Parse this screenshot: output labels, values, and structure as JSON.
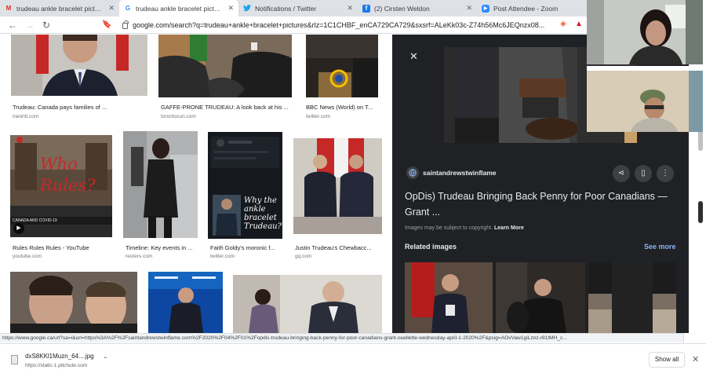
{
  "tabs": [
    {
      "icon": "gmail-icon",
      "title": "trudeau ankle bracelet pictures -",
      "active": false
    },
    {
      "icon": "google-icon",
      "title": "trudeau ankle bracelet pictures",
      "active": true
    },
    {
      "icon": "twitter-icon",
      "title": "Notifications / Twitter",
      "active": false
    },
    {
      "icon": "facebook-icon",
      "title": "(2) Cirsten Weldon",
      "active": false
    },
    {
      "icon": "zoom-icon",
      "title": "Post Attendee - Zoom",
      "active": false
    }
  ],
  "address_bar": {
    "url": "google.com/search?q=trudeau+ankle+bracelet+pictures&rlz=1C1CHBF_enCA729CA729&sxsrf=ALeKk03c-Z74h56Mc6JEQnzx08..."
  },
  "results": [
    {
      "caption": "Trudeau: Canada pays families of ...",
      "source": "iranintl.com"
    },
    {
      "caption": "GAFFE-PRONE TRUDEAU: A look back at his ...",
      "source": "torontosun.com"
    },
    {
      "caption": "BBC News (World) on T...",
      "source": "twitter.com"
    },
    {
      "caption": "Rules Rules Rules - YouTube",
      "source": "youtube.com"
    },
    {
      "caption": "Timeline: Key events in ...",
      "source": "reuters.com"
    },
    {
      "caption": "Faith Goldy's moronic f...",
      "source": "twitter.com"
    },
    {
      "caption": "Justin Trudeau's Chewbacc...",
      "source": "gq.com"
    }
  ],
  "thumb_text": {
    "youtube": "Who Rules?",
    "youtube_banner": "CANADA AND COVID-19",
    "twitter": "Why the ankle bracelet Trudeau?"
  },
  "preview": {
    "site": "saintandrewstwinflame",
    "title": "OpDis) Trudeau Bringing Back Penny for Poor Canadians — Grant ...",
    "copyright": "Images may be subject to copyright.",
    "learn_more": "Learn More",
    "related_heading": "Related images",
    "see_more": "See more"
  },
  "status_url": "https://www.google.ca/url?sa=i&url=https%3A%2F%2Fsaintandrewstwinflame.com%2F2020%2F04%2F01%2Fopdis-trudeau-bringing-back-penny-for-poor-canadians-grant-ouellette-wednesday-april-1-2020%2F&psig=AOvVaw1giLznz-r81tMH_c...",
  "download": {
    "filename": "dxS8KKl1Muzn_64....jpg",
    "url": "https://static-1.pitchute.com",
    "show_all": "Show all"
  }
}
